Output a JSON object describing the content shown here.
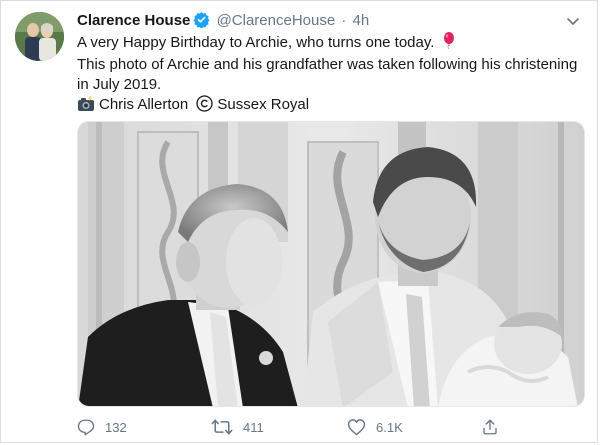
{
  "tweet": {
    "author_name": "Clarence House",
    "handle": "@ClarenceHouse",
    "separator": "·",
    "time": "4h",
    "text_line1": "A very Happy Birthday to Archie, who turns one today.",
    "text_line2": "This photo of Archie and his grandfather was taken following his christening",
    "text_line3": "in July 2019.",
    "credit_photographer": "Chris Allerton",
    "credit_copyright": "Sussex Royal",
    "icons": {
      "verified": "verified-badge-icon",
      "balloon": "balloon-icon",
      "camera": "camera-flash-icon",
      "copyright": "copyright-icon"
    }
  },
  "actions": {
    "reply_count": "132",
    "retweet_count": "411",
    "like_count": "6.1K"
  },
  "colors": {
    "accent": "#1da1f2",
    "secondary_text": "#657786",
    "balloon": "#e0245e"
  }
}
